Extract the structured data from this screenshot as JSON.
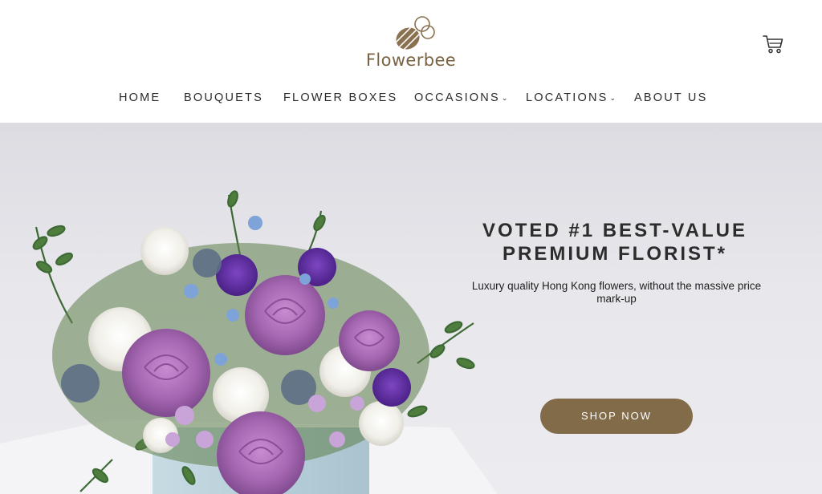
{
  "brand": {
    "name": "Flowerbee",
    "logo_icon": "bee-logo-icon",
    "color": "#7a6343"
  },
  "header": {
    "cart_icon": "cart-icon"
  },
  "nav": {
    "items": [
      {
        "label": "HOME",
        "has_dropdown": false
      },
      {
        "label": "BOUQUETS",
        "has_dropdown": false
      },
      {
        "label": "FLOWER BOXES",
        "has_dropdown": false
      },
      {
        "label": "OCCASIONS",
        "has_dropdown": true
      },
      {
        "label": "LOCATIONS",
        "has_dropdown": true
      },
      {
        "label": "ABOUT US",
        "has_dropdown": false
      }
    ],
    "dropdown_glyph": "⌄"
  },
  "hero": {
    "headline_line1": "VOTED #1 BEST-VALUE",
    "headline_line2": "PREMIUM FLORIST*",
    "subtitle": "Luxury quality Hong Kong flowers, without the massive price mark-up",
    "cta_label": "SHOP NOW",
    "image": "flower-box-bouquet-image"
  },
  "colors": {
    "accent": "#826b48",
    "text": "#2a2a2a",
    "hero_bg": "#e7e7ec"
  }
}
